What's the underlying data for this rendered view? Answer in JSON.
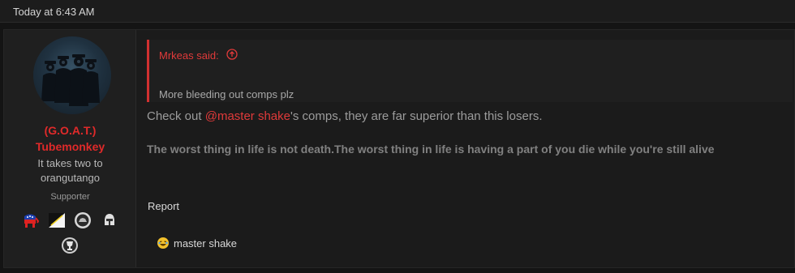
{
  "header": {
    "timestamp": "Today at 6:43 AM"
  },
  "user": {
    "name_line1": "(G.O.A.T.)",
    "name_line2": "Tubemonkey",
    "title_line1": "It takes two to",
    "title_line2": "orangutango",
    "banner": "Supporter",
    "name_color": "#e02a2a",
    "trophy_icons": [
      "elephant-icon",
      "flag-icon",
      "badge-icon",
      "helmet-icon",
      "trophy-icon"
    ]
  },
  "quote": {
    "author": "Mrkeas said:",
    "text": "More bleeding out comps plz"
  },
  "message": {
    "prefix": "Check out ",
    "mention": "@master shake",
    "suffix": "'s comps, they are far superior than this losers."
  },
  "signature": "The worst thing in life is not death.The worst thing in life is having a part of you die while you're still alive",
  "actions": {
    "report": "Report"
  },
  "reaction": {
    "icon": "laughing-emoji-icon",
    "user": "master shake"
  },
  "colors": {
    "accent": "#e03a3a",
    "background": "#141414",
    "panel": "#1b1b1b"
  }
}
